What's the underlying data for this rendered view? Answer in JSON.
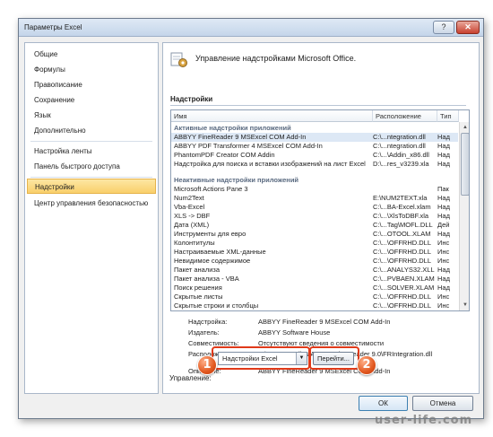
{
  "window": {
    "title": "Параметры Excel",
    "help_glyph": "?",
    "close_glyph": "✕"
  },
  "sidebar": {
    "items": [
      {
        "label": "Общие"
      },
      {
        "label": "Формулы"
      },
      {
        "label": "Правописание"
      },
      {
        "label": "Сохранение"
      },
      {
        "label": "Язык"
      },
      {
        "label": "Дополнительно"
      },
      {
        "label": "Настройка ленты"
      },
      {
        "label": "Панель быстрого доступа"
      },
      {
        "label": "Надстройки"
      },
      {
        "label": "Центр управления безопасностью"
      }
    ],
    "active": "Надстройки"
  },
  "content": {
    "header": "Управление надстройками Microsoft Office.",
    "section": "Надстройки",
    "columns": [
      "Имя",
      "Расположение",
      "Тип"
    ],
    "groups": [
      {
        "title": "Активные надстройки приложений",
        "rows": [
          {
            "name": "ABBYY FineReader 9 MSExcel COM Add-In",
            "location": "C:\\...ntegration.dll",
            "type": "Над",
            "selected": true
          },
          {
            "name": "ABBYY PDF Transformer 4 MSExcel COM Add-In",
            "location": "C:\\...ntegration.dll",
            "type": "Над"
          },
          {
            "name": "PhantomPDF Creator COM Addin",
            "location": "C:\\...\\Addin_x86.dll",
            "type": "Над"
          },
          {
            "name": "Надстройка для поиска и вставки изображений на лист Excel",
            "location": "D:\\...res_v3239.xla",
            "type": "Над"
          }
        ]
      },
      {
        "title": "Неактивные надстройки приложений",
        "rows": [
          {
            "name": "Microsoft Actions Pane 3",
            "location": "",
            "type": "Пак"
          },
          {
            "name": "Num2Text",
            "location": "E:\\NUM2TEXT.xla",
            "type": "Над"
          },
          {
            "name": "Vba-Excel",
            "location": "C:\\...BA-Excel.xlam",
            "type": "Над"
          },
          {
            "name": "XLS -> DBF",
            "location": "C:\\...\\XlsToDBF.xla",
            "type": "Над"
          },
          {
            "name": "Дата (XML)",
            "location": "C:\\...Tag\\MOFL.DLL",
            "type": "Дей"
          },
          {
            "name": "Инструменты для евро",
            "location": "C:\\...OTOOL.XLAM",
            "type": "Над"
          },
          {
            "name": "Колонтитулы",
            "location": "C:\\...\\OFFRHD.DLL",
            "type": "Инс"
          },
          {
            "name": "Настраиваемые XML-данные",
            "location": "C:\\...\\OFFRHD.DLL",
            "type": "Инс"
          },
          {
            "name": "Невидимое содержимое",
            "location": "C:\\...\\OFFRHD.DLL",
            "type": "Инс"
          },
          {
            "name": "Пакет анализа",
            "location": "C:\\...ANALYS32.XLL",
            "type": "Над"
          },
          {
            "name": "Пакет анализа - VBA",
            "location": "C:\\...PVBAEN.XLAM",
            "type": "Над"
          },
          {
            "name": "Поиск решения",
            "location": "C:\\...SOLVER.XLAM",
            "type": "Над"
          },
          {
            "name": "Скрытые листы",
            "location": "C:\\...\\OFFRHD.DLL",
            "type": "Инс"
          },
          {
            "name": "Скрытые строки и столбцы",
            "location": "C:\\...\\OFFRHD.DLL",
            "type": "Инс"
          }
        ]
      }
    ],
    "details": {
      "addin_label": "Надстройка:",
      "addin_value": "ABBYY FineReader 9 MSExcel COM Add-In",
      "publisher_label": "Издатель:",
      "publisher_value": "ABBYY Software House",
      "compat_label": "Совместимость:",
      "compat_value": "Отсутствуют сведения о совместимости",
      "location_label": "Расположение:",
      "location_value": "C:\\Program Files\\ABBYY FineReader 9.0\\FRIntegration.dll",
      "desc_label": "Описание:",
      "desc_value": "ABBYY FineReader 9 MSExcel COM Add-In"
    },
    "management": {
      "label": "Управление:",
      "selected": "Надстройки Excel",
      "go_button": "Перейти..."
    }
  },
  "callouts": [
    "1",
    "2"
  ],
  "footer": {
    "ok": "ОК",
    "cancel": "Отмена"
  },
  "watermark": "user-life.com",
  "accent": {
    "active_nav": "#f9cf6a",
    "highlight": "#e03a1a"
  }
}
